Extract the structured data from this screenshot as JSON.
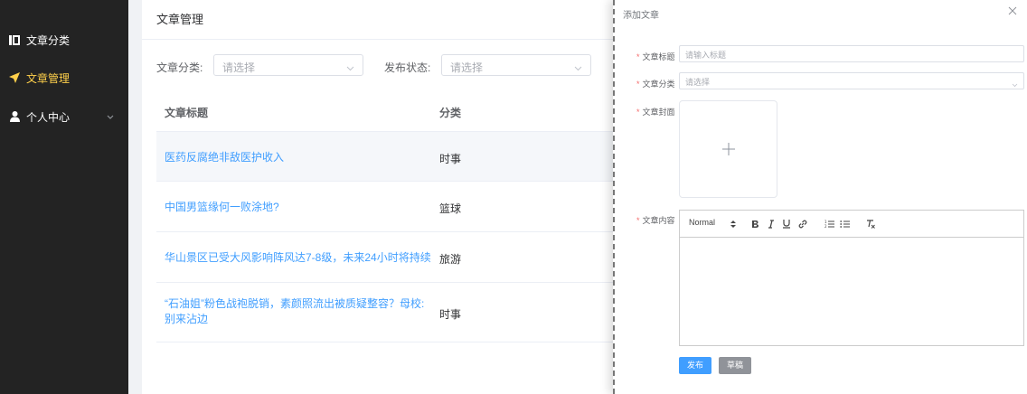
{
  "sidebar": {
    "items": [
      {
        "label": "文章分类",
        "icon": "category-icon"
      },
      {
        "label": "文章管理",
        "icon": "send-icon",
        "active": true
      },
      {
        "label": "个人中心",
        "icon": "user-icon",
        "expandable": true
      }
    ],
    "background": "#232323",
    "active_color": "#ffd04b"
  },
  "main": {
    "title": "文章管理",
    "filters": {
      "category_label": "文章分类:",
      "category_placeholder": "请选择",
      "status_label": "发布状态:",
      "status_placeholder": "请选择"
    },
    "table": {
      "columns": [
        "文章标题",
        "分类"
      ],
      "rows": [
        {
          "title": "医药反腐绝非敌医护收入",
          "category": "时事"
        },
        {
          "title": "中国男篮缘何一败涂地?",
          "category": "篮球"
        },
        {
          "title": "华山景区已受大风影响阵风达7-8级，未来24小时将持续",
          "category": "旅游"
        },
        {
          "title_line1": "“石油姐”粉色战袍脱销，素颜照流出被质疑整容？母校:",
          "title_line2": "别来沾边",
          "category": "时事"
        }
      ]
    }
  },
  "drawer": {
    "title": "添加文章",
    "fields": {
      "title_label": "文章标题",
      "title_placeholder": "请输入标题",
      "category_label": "文章分类",
      "category_placeholder": "请选择",
      "cover_label": "文章封面",
      "content_label": "文章内容"
    },
    "editor_toolbar": {
      "header_select": "Normal",
      "buttons": [
        "bold",
        "italic",
        "underline",
        "link",
        "ordered-list",
        "bullet-list",
        "clean"
      ]
    },
    "buttons": {
      "publish": "发布",
      "draft": "草稿"
    },
    "colors": {
      "primary": "#409eff",
      "info": "#909399",
      "required": "#f56c6c"
    }
  }
}
